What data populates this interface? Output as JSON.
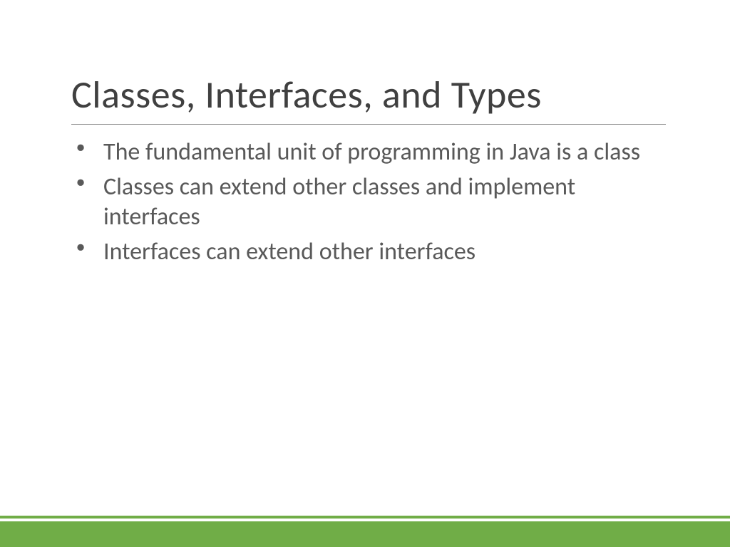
{
  "slide": {
    "title": "Classes, Interfaces, and Types",
    "bullets": [
      "The fundamental unit of programming in Java is a class",
      "Classes can extend other classes and implement interfaces",
      "Interfaces can extend other interfaces"
    ]
  },
  "colors": {
    "accent": "#70ad47",
    "title_text": "#404040",
    "body_text": "#595959"
  }
}
